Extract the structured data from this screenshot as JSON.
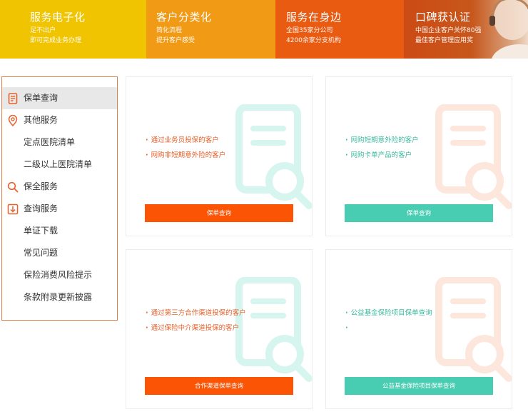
{
  "banner": [
    {
      "title": "服务电子化",
      "line1": "足不出户",
      "line2": "即可完成业务办理"
    },
    {
      "title": "客户分类化",
      "line1": "简化流程",
      "line2": "提升客户感受"
    },
    {
      "title": "服务在身边",
      "line1": "全国35家分公司",
      "line2": "4200余家分支机构"
    },
    {
      "title": "口碑获认证",
      "line1": "中国企业客户关怀80强",
      "line2": "最佳客户管理应用奖"
    }
  ],
  "sidebar": {
    "items": [
      {
        "label": "保单查询",
        "icon": "policy-doc-icon",
        "active": true
      },
      {
        "label": "其他服务",
        "icon": "location-pin-icon"
      },
      {
        "label": "定点医院清单"
      },
      {
        "label": "二级以上医院清单"
      },
      {
        "label": "保全服务",
        "icon": "magnifier-icon"
      },
      {
        "label": "查询服务",
        "icon": "download-icon"
      },
      {
        "label": "单证下载"
      },
      {
        "label": "常见问题"
      },
      {
        "label": "保险消费风险提示"
      },
      {
        "label": "条款附录更新披露"
      }
    ]
  },
  "cards": [
    {
      "lines": [
        "通过业务员投保的客户",
        "网购非短期意外险的客户"
      ],
      "button": "保单查询",
      "theme": "orange"
    },
    {
      "lines": [
        "网购短期意外险的客户",
        "网购卡单产品的客户"
      ],
      "button": "保单查询",
      "theme": "teal"
    },
    {
      "lines": [
        "通过第三方合作渠道投保的客户",
        "通过保险中介渠道投保的客户"
      ],
      "button": "合作渠道保单查询",
      "theme": "orange"
    },
    {
      "lines": [
        "公益基金保险项目保单查询",
        ""
      ],
      "button": "公益基金保险项目保单查询",
      "theme": "teal"
    }
  ],
  "colors": {
    "orange": "#fc5405",
    "teal": "#48ccb2",
    "sidebar_border": "#e0804a"
  }
}
